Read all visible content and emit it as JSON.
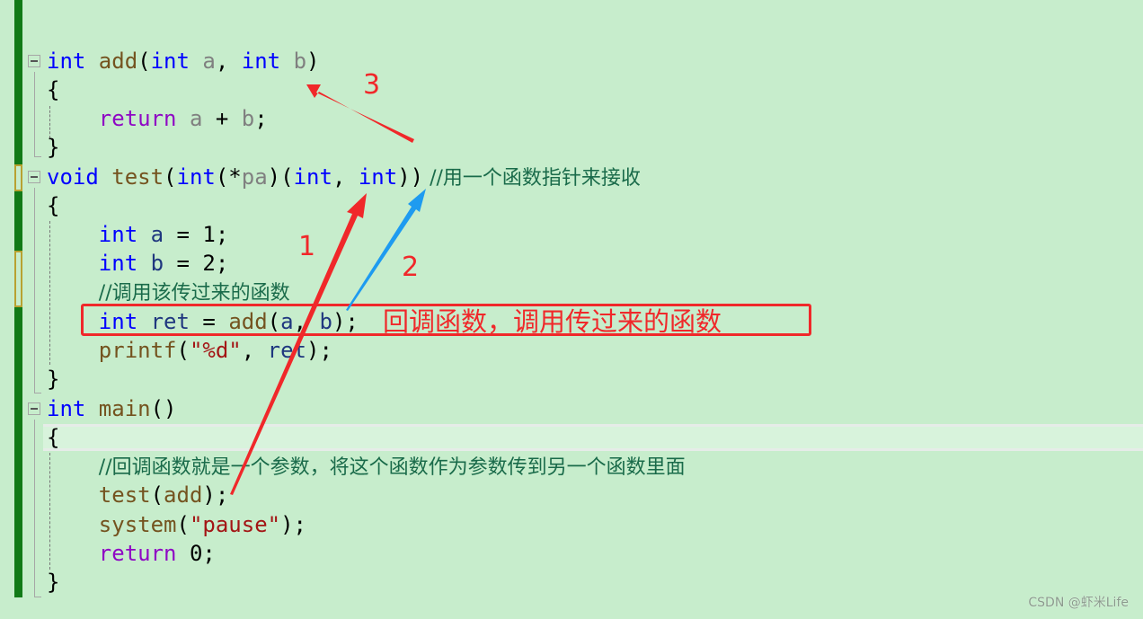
{
  "editor": {
    "lines": [
      {
        "id": "add-sig",
        "tokens": [
          [
            "kw",
            "int"
          ],
          [
            "",
            ""
          ],
          [
            "fn",
            " add"
          ],
          [
            "",
            "("
          ],
          [
            "kw",
            "int"
          ],
          [
            "param",
            " a"
          ],
          [
            "",
            ", "
          ],
          [
            "kw",
            "int"
          ],
          [
            "param",
            " b"
          ],
          [
            "",
            ")"
          ]
        ]
      },
      {
        "id": "add-open",
        "tokens": [
          [
            "",
            "{"
          ]
        ]
      },
      {
        "id": "add-return",
        "tokens": [
          [
            "",
            "    "
          ],
          [
            "ctl",
            "return"
          ],
          [
            "param",
            " a"
          ],
          [
            "",
            " + "
          ],
          [
            "param",
            "b"
          ],
          [
            "",
            ";"
          ]
        ]
      },
      {
        "id": "add-close",
        "tokens": [
          [
            "",
            "}"
          ]
        ]
      },
      {
        "id": "test-sig",
        "tokens": [
          [
            "kw",
            "void"
          ],
          [
            "fn",
            " test"
          ],
          [
            "",
            "("
          ],
          [
            "kw",
            "int"
          ],
          [
            "",
            "(*"
          ],
          [
            "param",
            "pa"
          ],
          [
            "",
            ")("
          ],
          [
            "kw",
            "int"
          ],
          [
            "",
            ", "
          ],
          [
            "kw",
            "int"
          ],
          [
            "",
            "))"
          ],
          [
            "cmt",
            " //用一个函数指针来接收"
          ]
        ]
      },
      {
        "id": "test-open",
        "tokens": [
          [
            "",
            "{"
          ]
        ]
      },
      {
        "id": "test-a",
        "tokens": [
          [
            "",
            "    "
          ],
          [
            "kw",
            "int"
          ],
          [
            "local",
            " a"
          ],
          [
            "",
            " = 1;"
          ]
        ]
      },
      {
        "id": "test-b",
        "tokens": [
          [
            "",
            "    "
          ],
          [
            "kw",
            "int"
          ],
          [
            "local",
            " b"
          ],
          [
            "",
            " = 2;"
          ]
        ]
      },
      {
        "id": "test-comment",
        "tokens": [
          [
            "",
            "    "
          ],
          [
            "cmt",
            "//调用该传过来的函数"
          ]
        ]
      },
      {
        "id": "test-ret",
        "tokens": [
          [
            "",
            "    "
          ],
          [
            "kw",
            "int"
          ],
          [
            "local",
            " ret"
          ],
          [
            "",
            " = "
          ],
          [
            "fn",
            "add"
          ],
          [
            "",
            "("
          ],
          [
            "local",
            "a"
          ],
          [
            "",
            ", "
          ],
          [
            "local",
            "b"
          ],
          [
            "",
            ");"
          ]
        ]
      },
      {
        "id": "test-printf",
        "tokens": [
          [
            "",
            "    "
          ],
          [
            "fn",
            "printf"
          ],
          [
            "",
            "("
          ],
          [
            "str",
            "\"%d\""
          ],
          [
            "",
            ", "
          ],
          [
            "local",
            "ret"
          ],
          [
            "",
            ");"
          ]
        ]
      },
      {
        "id": "test-close",
        "tokens": [
          [
            "",
            "}"
          ]
        ]
      },
      {
        "id": "main-sig",
        "tokens": [
          [
            "kw",
            "int"
          ],
          [
            "fn",
            " main"
          ],
          [
            "",
            "()"
          ]
        ]
      },
      {
        "id": "main-open",
        "tokens": [
          [
            "",
            "{"
          ]
        ]
      },
      {
        "id": "main-comment",
        "tokens": [
          [
            "",
            "    "
          ],
          [
            "cmt",
            "//回调函数就是一个参数，将这个函数作为参数传到另一个函数里面"
          ]
        ]
      },
      {
        "id": "main-test",
        "tokens": [
          [
            "",
            "    "
          ],
          [
            "fn",
            "test"
          ],
          [
            "",
            "("
          ],
          [
            "fn",
            "add"
          ],
          [
            "",
            ");"
          ]
        ]
      },
      {
        "id": "main-system",
        "tokens": [
          [
            "",
            "    "
          ],
          [
            "fn",
            "system"
          ],
          [
            "",
            "("
          ],
          [
            "str",
            "\"pause\""
          ],
          [
            "",
            ");"
          ]
        ]
      },
      {
        "id": "main-return",
        "tokens": [
          [
            "",
            "    "
          ],
          [
            "ctl",
            "return"
          ],
          [
            "",
            " 0;"
          ]
        ]
      },
      {
        "id": "main-close",
        "tokens": [
          [
            "",
            "}"
          ]
        ]
      }
    ]
  },
  "annotations": {
    "callout_text": "回调函数，调用传过来的函数",
    "labels": [
      "1",
      "2",
      "3"
    ],
    "colors": {
      "red": "#f0282a",
      "blue": "#1e9bf0"
    }
  },
  "watermark": "CSDN @虾米Life"
}
